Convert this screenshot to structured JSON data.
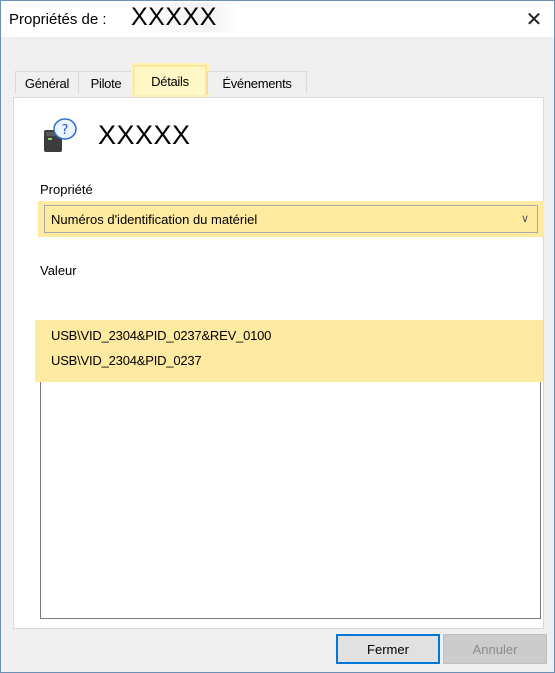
{
  "window": {
    "title_prefix": "Propriétés de :",
    "device_name": "XXXXX",
    "close_glyph": "✕"
  },
  "tabs": [
    {
      "label": "Général",
      "active": false
    },
    {
      "label": "Pilote",
      "active": false
    },
    {
      "label": "Détails",
      "active": true
    },
    {
      "label": "Événements",
      "active": false
    }
  ],
  "panel": {
    "device_name": "XXXXX",
    "device_icon": "unknown-device-icon",
    "property_label": "Propriété",
    "property_selected": "Numéros d'identification du matériel",
    "dropdown_arrow": "∨",
    "value_label": "Valeur",
    "values": [
      "USB\\VID_2304&PID_0237&REV_0100",
      "USB\\VID_2304&PID_0237"
    ]
  },
  "buttons": {
    "close": "Fermer",
    "cancel": "Annuler"
  },
  "colors": {
    "highlight": "#ffeaa2",
    "accent_border": "#0078d7",
    "window_border": "#6d8fb5"
  }
}
